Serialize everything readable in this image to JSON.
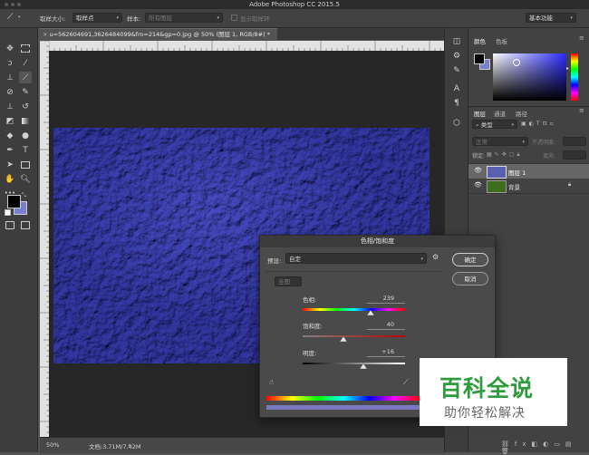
{
  "window": {
    "title": "Adobe Photoshop CC 2015.5"
  },
  "options_bar": {
    "sample_size_label": "取样大小:",
    "sample_size_value": "取样点",
    "sample_label": "样本:",
    "sample_value": "所有图层",
    "show_ring_label": "显示取样环",
    "workspace": "基本功能"
  },
  "document": {
    "tab_title": "u=562604691,3626484099&fm=214&gp=0.jpg @ 50% (图层 1, RGB/8#) *",
    "zoom": "50%",
    "doc_size": "文档:3.71M/7.42M"
  },
  "panels": {
    "color_tab": "颜色",
    "swatches_tab": "色板",
    "layers_tab": "图层",
    "channels_tab": "通道",
    "paths_tab": "路径",
    "kind_label": "类型",
    "blend_mode": "正常",
    "opacity_label": "不透明度:",
    "lock_label": "锁定:",
    "fill_label": "填充:",
    "layers": [
      {
        "name": "图层 1"
      },
      {
        "name": "背景"
      }
    ]
  },
  "dialog": {
    "title": "色相/饱和度",
    "preset_label": "预设:",
    "preset_value": "自定",
    "channel_value": "全图",
    "ok_label": "确定",
    "cancel_label": "取消",
    "hue_label": "色相:",
    "hue_value": "239",
    "saturation_label": "饱和度:",
    "saturation_value": "40",
    "lightness_label": "明度:",
    "lightness_value": "+16"
  },
  "watermark": {
    "line1": "百科全说",
    "line2": "助你轻松解决"
  },
  "colors": {
    "image_tint": "#5a5fb0",
    "watermark_green": "#2e9b3c",
    "foreground": "#000000",
    "background_swatch": "#7b7fd0"
  }
}
